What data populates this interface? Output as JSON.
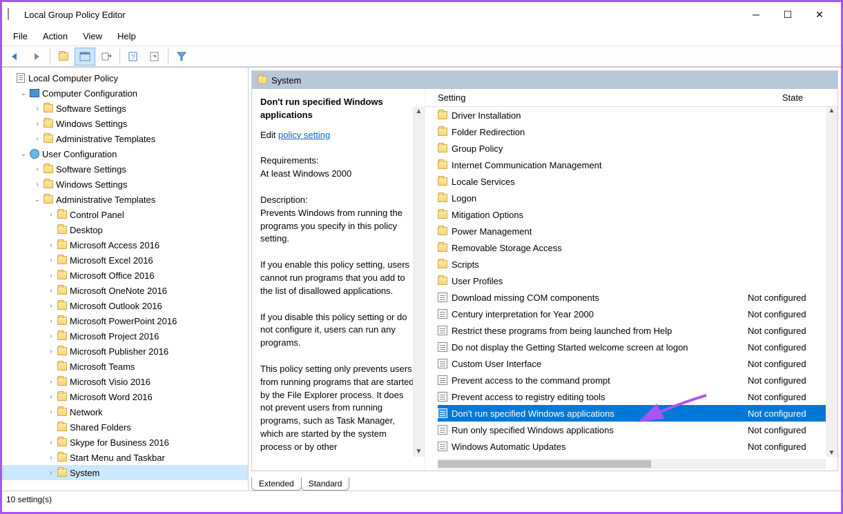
{
  "window": {
    "title": "Local Group Policy Editor",
    "menus": [
      "File",
      "Action",
      "View",
      "Help"
    ]
  },
  "tree": [
    {
      "d": 0,
      "exp": "",
      "icon": "doc",
      "label": "Local Computer Policy"
    },
    {
      "d": 1,
      "exp": "v",
      "icon": "pc",
      "label": "Computer Configuration"
    },
    {
      "d": 2,
      "exp": ">",
      "icon": "folder",
      "label": "Software Settings"
    },
    {
      "d": 2,
      "exp": ">",
      "icon": "folder",
      "label": "Windows Settings"
    },
    {
      "d": 2,
      "exp": ">",
      "icon": "folder",
      "label": "Administrative Templates"
    },
    {
      "d": 1,
      "exp": "v",
      "icon": "user",
      "label": "User Configuration"
    },
    {
      "d": 2,
      "exp": ">",
      "icon": "folder",
      "label": "Software Settings"
    },
    {
      "d": 2,
      "exp": ">",
      "icon": "folder",
      "label": "Windows Settings"
    },
    {
      "d": 2,
      "exp": "v",
      "icon": "folder",
      "label": "Administrative Templates"
    },
    {
      "d": 3,
      "exp": ">",
      "icon": "folder",
      "label": "Control Panel"
    },
    {
      "d": 3,
      "exp": "",
      "icon": "folder",
      "label": "Desktop"
    },
    {
      "d": 3,
      "exp": ">",
      "icon": "folder",
      "label": "Microsoft Access 2016"
    },
    {
      "d": 3,
      "exp": ">",
      "icon": "folder",
      "label": "Microsoft Excel 2016"
    },
    {
      "d": 3,
      "exp": ">",
      "icon": "folder",
      "label": "Microsoft Office 2016"
    },
    {
      "d": 3,
      "exp": ">",
      "icon": "folder",
      "label": "Microsoft OneNote 2016"
    },
    {
      "d": 3,
      "exp": ">",
      "icon": "folder",
      "label": "Microsoft Outlook 2016"
    },
    {
      "d": 3,
      "exp": ">",
      "icon": "folder",
      "label": "Microsoft PowerPoint 2016"
    },
    {
      "d": 3,
      "exp": ">",
      "icon": "folder",
      "label": "Microsoft Project 2016"
    },
    {
      "d": 3,
      "exp": ">",
      "icon": "folder",
      "label": "Microsoft Publisher 2016"
    },
    {
      "d": 3,
      "exp": "",
      "icon": "folder",
      "label": "Microsoft Teams"
    },
    {
      "d": 3,
      "exp": ">",
      "icon": "folder",
      "label": "Microsoft Visio 2016"
    },
    {
      "d": 3,
      "exp": ">",
      "icon": "folder",
      "label": "Microsoft Word 2016"
    },
    {
      "d": 3,
      "exp": ">",
      "icon": "folder",
      "label": "Network"
    },
    {
      "d": 3,
      "exp": "",
      "icon": "folder",
      "label": "Shared Folders"
    },
    {
      "d": 3,
      "exp": ">",
      "icon": "folder",
      "label": "Skype for Business 2016"
    },
    {
      "d": 3,
      "exp": ">",
      "icon": "folder",
      "label": "Start Menu and Taskbar"
    },
    {
      "d": 3,
      "exp": ">",
      "icon": "folder",
      "label": "System",
      "selected": true
    }
  ],
  "pathbar": "System",
  "detail": {
    "title": "Don't run specified Windows applications",
    "editPre": "Edit",
    "editLink": "policy setting",
    "reqLabel": "Requirements:",
    "reqText": "At least Windows 2000",
    "descLabel": "Description:",
    "desc1": "Prevents Windows from running the programs you specify in this policy setting.",
    "desc2": "If you enable this policy setting, users cannot run programs that you add to the list of disallowed applications.",
    "desc3": "If you disable this policy setting or do not configure it, users can run any programs.",
    "desc4": "This policy setting only prevents users from running programs that are started by the File Explorer process. It does not prevent users from running programs, such as Task Manager, which are started by the system process or by other"
  },
  "columns": {
    "c1": "Setting",
    "c2": "State"
  },
  "settings": [
    {
      "t": "folder",
      "label": "Driver Installation"
    },
    {
      "t": "folder",
      "label": "Folder Redirection"
    },
    {
      "t": "folder",
      "label": "Group Policy"
    },
    {
      "t": "folder",
      "label": "Internet Communication Management"
    },
    {
      "t": "folder",
      "label": "Locale Services"
    },
    {
      "t": "folder",
      "label": "Logon"
    },
    {
      "t": "folder",
      "label": "Mitigation Options"
    },
    {
      "t": "folder",
      "label": "Power Management"
    },
    {
      "t": "folder",
      "label": "Removable Storage Access"
    },
    {
      "t": "folder",
      "label": "Scripts"
    },
    {
      "t": "folder",
      "label": "User Profiles"
    },
    {
      "t": "setting",
      "label": "Download missing COM components",
      "state": "Not configured"
    },
    {
      "t": "setting",
      "label": "Century interpretation for Year 2000",
      "state": "Not configured"
    },
    {
      "t": "setting",
      "label": "Restrict these programs from being launched from Help",
      "state": "Not configured"
    },
    {
      "t": "setting",
      "label": "Do not display the Getting Started welcome screen at logon",
      "state": "Not configured"
    },
    {
      "t": "setting",
      "label": "Custom User Interface",
      "state": "Not configured"
    },
    {
      "t": "setting",
      "label": "Prevent access to the command prompt",
      "state": "Not configured"
    },
    {
      "t": "setting",
      "label": "Prevent access to registry editing tools",
      "state": "Not configured"
    },
    {
      "t": "setting",
      "label": "Don't run specified Windows applications",
      "state": "Not configured",
      "selected": true
    },
    {
      "t": "setting",
      "label": "Run only specified Windows applications",
      "state": "Not configured"
    },
    {
      "t": "setting",
      "label": "Windows Automatic Updates",
      "state": "Not configured"
    }
  ],
  "tabs": {
    "extended": "Extended",
    "standard": "Standard"
  },
  "status": "10 setting(s)"
}
